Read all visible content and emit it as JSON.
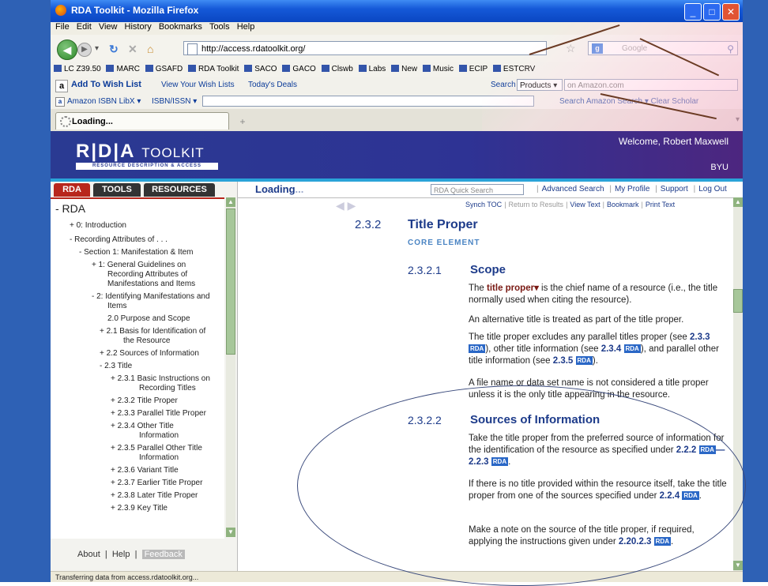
{
  "window": {
    "title": "RDA Toolkit - Mozilla Firefox"
  },
  "menu": [
    "File",
    "Edit",
    "View",
    "History",
    "Bookmarks",
    "Tools",
    "Help"
  ],
  "nav": {
    "url": "http://access.rdatoolkit.org/",
    "search_placeholder": "Google"
  },
  "bookmarks": [
    "LC Z39.50",
    "MARC",
    "GSAFD",
    "RDA Toolkit",
    "SACO",
    "GACO",
    "Clswb",
    "Labs",
    "New",
    "Music",
    "ECIP",
    "ESTCRV"
  ],
  "amazon": {
    "wish": "Add To Wish List",
    "view_wish": "View Your Wish Lists",
    "deals": "Today's Deals",
    "search": "Search",
    "products": "Products ▾",
    "input": "on Amazon.com"
  },
  "isbn": {
    "label": "Amazon ISBN LibX ▾",
    "type": "ISBN/ISSN ▾",
    "right": "Search Amazon Search  ▾  Clear  Scholar"
  },
  "tab": {
    "title": "Loading..."
  },
  "header": {
    "logo": "R|D|A",
    "logo_tk": "TOOLKIT",
    "sub": "RESOURCE DESCRIPTION & ACCESS",
    "welcome": "Welcome, Robert Maxwell",
    "org": "BYU"
  },
  "left_tabs": [
    "RDA",
    "TOOLS",
    "RESOURCES"
  ],
  "toc": [
    "- RDA",
    "+ 0: Introduction",
    "- Recording Attributes of . . .",
    "- Section 1: Manifestation & Item",
    "+ 1: General Guidelines on",
    "Recording Attributes of",
    "Manifestations and Items",
    "- 2: Identifying Manifestations and",
    "Items",
    "2.0 Purpose and Scope",
    "+ 2.1 Basis for Identification of",
    "the Resource",
    "+ 2.2 Sources of Information",
    "- 2.3 Title",
    "+ 2.3.1 Basic Instructions on",
    "Recording Titles",
    "+ 2.3.2 Title Proper",
    "+ 2.3.3 Parallel Title Proper",
    "+ 2.3.4 Other Title",
    "Information",
    "+ 2.3.5 Parallel Other Title",
    "Information",
    "+ 2.3.6 Variant Title",
    "+ 2.3.7 Earlier Title Proper",
    "+ 2.3.8 Later Title Proper",
    "+ 2.3.9 Key Title"
  ],
  "left_footer": {
    "about": "About",
    "help": "Help",
    "feedback": "Feedback"
  },
  "main_top": {
    "loading": "Loading",
    "dots": "...",
    "quick_search": "RDA Quick Search",
    "links": [
      "Advanced Search",
      "My Profile",
      "Support",
      "Log Out"
    ]
  },
  "synch": {
    "synch_toc": "Synch TOC",
    "return": "Return to Results",
    "view_text": "View Text",
    "bookmark": "Bookmark",
    "print_text": "Print Text"
  },
  "content": {
    "sec_num": "2.3.2",
    "sec_title": "Title Proper",
    "core": "CORE ELEMENT",
    "scope_num": "2.3.2.1",
    "scope_title": "Scope",
    "p1_a": "The ",
    "p1_b": "title proper▾",
    "p1_c": " is the chief name of a resource (i.e., the title normally used when citing the resource).",
    "p2": "An alternative title is treated as part of the title proper.",
    "p3_a": "The title proper excludes any parallel titles proper (see ",
    "p3_ref1": "2.3.3",
    "p3_b": "), other title information (see ",
    "p3_ref2": "2.3.4",
    "p3_c": "), and parallel other title information (see ",
    "p3_ref3": "2.3.5",
    "p3_d": ").",
    "p4": "A file name or data set name is not considered a title proper unless it is the only title appearing in the resource.",
    "src_num": "2.3.2.2",
    "src_title": "Sources of Information",
    "p5_a": "Take the title proper from the preferred source of information for the identification of the resource as specified under ",
    "p5_ref1": "2.2.2",
    "p5_ref2": "—2.2.3",
    "p5_b": ".",
    "p6_a": "If there is no title provided within the resource itself, take the title proper from one of the sources specified under ",
    "p6_ref": "2.2.4",
    "p6_b": ".",
    "p7_a": "Make a note on the source of the title proper, if required, applying the instructions given under ",
    "p7_ref": "2.20.2.3",
    "p7_b": ".",
    "badge": "RDA"
  },
  "status": "Transferring data from access.rdatoolkit.org...",
  "colors": {
    "accent": "#1d3b8a",
    "rda_red": "#b8261c",
    "slide_blue": "#2e61b5",
    "header_blue": "#2a3a92"
  }
}
